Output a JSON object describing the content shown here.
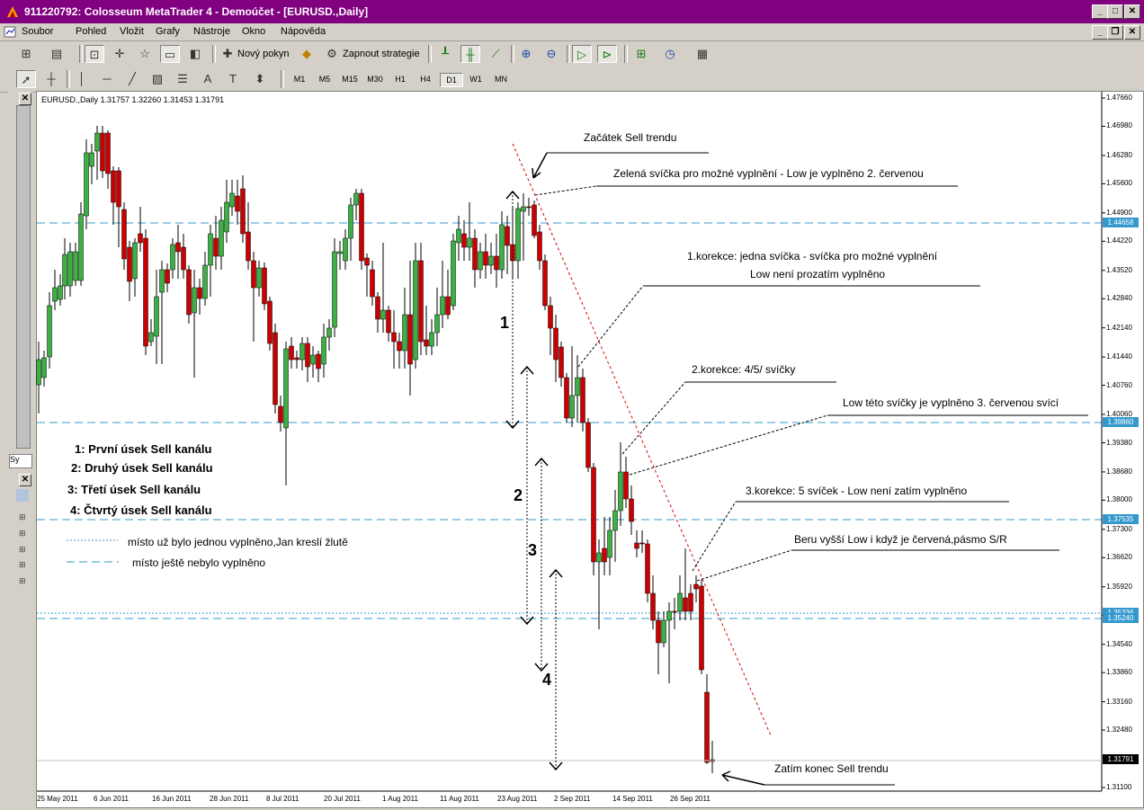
{
  "window": {
    "title": "911220792: Colosseum MetaTrader 4 - Demoúčet - [EURUSD.,Daily]"
  },
  "menu": [
    "Soubor",
    "Pohled",
    "Vložit",
    "Grafy",
    "Nástroje",
    "Okno",
    "Nápověda"
  ],
  "toolbar": {
    "new_order": "Nový pokyn",
    "strategy": "Zapnout strategie"
  },
  "timeframes": [
    "M1",
    "M5",
    "M15",
    "M30",
    "H1",
    "H4",
    "D1",
    "W1",
    "MN"
  ],
  "active_timeframe": "D1",
  "chart": {
    "symbol_line": "EURUSD.,Daily  1.31757 1.32260 1.31453 1.31791",
    "current_price": "1.31791",
    "prices": [
      "1.47660",
      "1.46980",
      "1.46280",
      "1.45600",
      "1.44900",
      "1.44220",
      "1.43520",
      "1.42840",
      "1.42140",
      "1.41440",
      "1.40760",
      "1.40060",
      "1.39380",
      "1.38680",
      "1.38000",
      "1.37300",
      "1.36620",
      "1.35920",
      "1.35240",
      "1.34540",
      "1.33860",
      "1.33160",
      "1.32480",
      "1.31100"
    ],
    "levels": [
      "1.44658",
      "1.39860",
      "1.37535",
      "1.35336",
      "1.35240"
    ],
    "dates": [
      "25 May 2011",
      "6 Jun 2011",
      "16 Jun 2011",
      "28 Jun 2011",
      "8 Jul 2011",
      "20 Jul 2011",
      "1 Aug 2011",
      "11 Aug 2011",
      "23 Aug 2011",
      "2 Sep 2011",
      "14 Sep 2011",
      "26 Sep 2011"
    ]
  },
  "annotations": {
    "start": "Začátek Sell trendu",
    "green": "Zelená svíčka pro možné vyplnění - Low je vyplněno 2. červenou",
    "corr1a": "1.korekce: jedna svíčka - svíčka pro možné vyplnění",
    "corr1b": "Low není prozatím vyplněno",
    "corr2": "2.korekce: 4/5/ svíčky",
    "lowcandle": "Low této svíčky je vyplněno 3. červenou svící",
    "corr3": "3.korekce: 5 svíček - Low není zatím vyplněno",
    "higherlow": "Beru vyšší Low i když je červená,pásmo S/R",
    "end": "Zatím konec Sell trendu"
  },
  "legend": {
    "l1": "1: První úsek Sell kanálu",
    "l2": "2: Druhý úsek Sell kanálu",
    "l3": "3: Třetí úsek Sell kanálu",
    "l4": "4: Čtvrtý úsek Sell kanálu",
    "dotted": "místo už bylo jednou vyplněno,Jan kreslí žlutě",
    "dashed": "místo ještě nebylo vyplněno"
  },
  "segment_numbers": [
    "1",
    "2",
    "3",
    "4"
  ],
  "colors": {
    "bull": "#3cb043",
    "bear": "#cc0000",
    "level": "#3399cc",
    "trend": "#dd0000",
    "title": "#800080"
  }
}
